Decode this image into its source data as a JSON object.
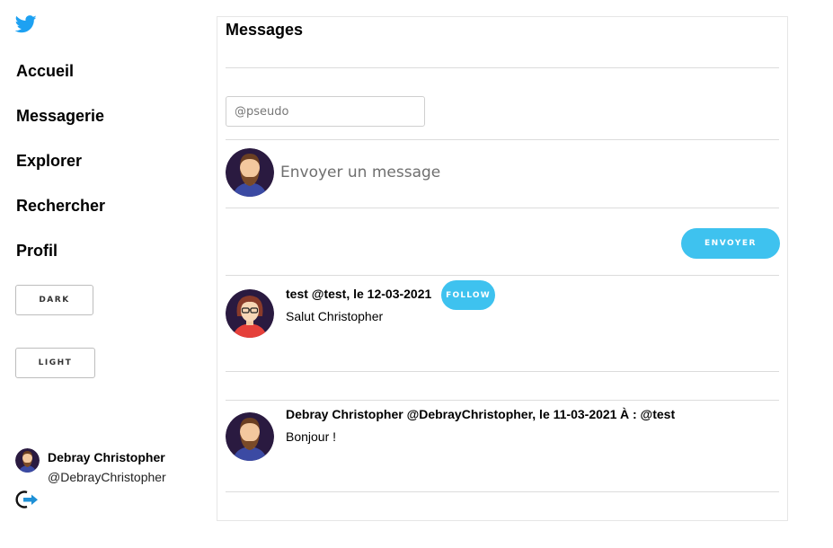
{
  "sidebar": {
    "logo_icon": "twitter-bird-icon",
    "nav": [
      {
        "label": "Accueil"
      },
      {
        "label": "Messagerie"
      },
      {
        "label": "Explorer"
      },
      {
        "label": "Rechercher"
      },
      {
        "label": "Profil"
      }
    ],
    "theme_buttons": {
      "dark": "DARK",
      "light": "LIGHT"
    },
    "user": {
      "name": "Debray Christopher",
      "handle": "@DebrayChristopher"
    },
    "logout_icon": "logout-icon"
  },
  "main": {
    "title": "Messages",
    "recipient_placeholder": "@pseudo",
    "compose_placeholder": "Envoyer un message",
    "send_label": "ENVOYER",
    "messages": [
      {
        "header": "test  @test, le 12-03-2021",
        "follow_label": "FOLLOW",
        "text": "Salut Christopher",
        "avatar": "female-avatar"
      },
      {
        "header": "Debray Christopher @DebrayChristopher, le 11-03-2021",
        "recipient": "À : @test",
        "text": "Bonjour !",
        "avatar": "bearded-male-avatar"
      }
    ]
  },
  "colors": {
    "accent": "#3ec2ef",
    "twitter_blue": "#1da1f2",
    "border": "#dcdcdc"
  }
}
